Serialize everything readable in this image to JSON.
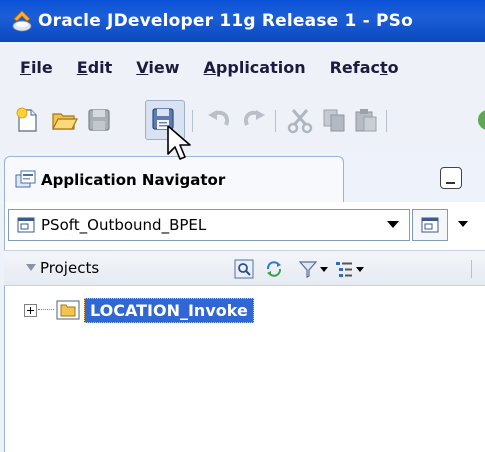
{
  "window": {
    "title": "Oracle JDeveloper 11g Release 1 - PSo"
  },
  "menubar": {
    "items": [
      {
        "label": "File",
        "underline": "F",
        "rest": "ile"
      },
      {
        "label": "Edit",
        "underline": "E",
        "rest": "dit"
      },
      {
        "label": "View",
        "underline": "V",
        "rest": "iew"
      },
      {
        "label": "Application",
        "underline": "A",
        "rest": "pplication"
      },
      {
        "label": "Refacto",
        "pre": "Refac",
        "underline": "t",
        "rest": "o"
      }
    ]
  },
  "toolbar": {
    "icons": [
      "new-icon",
      "open-icon",
      "save-icon",
      "save-all-icon",
      "undo-icon",
      "redo-icon",
      "cut-icon",
      "copy-icon",
      "paste-icon",
      "run-icon"
    ],
    "pressed": "save-all-icon"
  },
  "navigator": {
    "title": "Application Navigator",
    "application": "PSoft_Outbound_BPEL",
    "projects_label": "Projects",
    "tree": [
      {
        "label": "LOCATION_Invoke",
        "selected": true,
        "expanded": false
      }
    ]
  },
  "colors": {
    "titlebar": "#0a52d8",
    "selection": "#3167d4",
    "panel_border": "#9db3d4"
  }
}
